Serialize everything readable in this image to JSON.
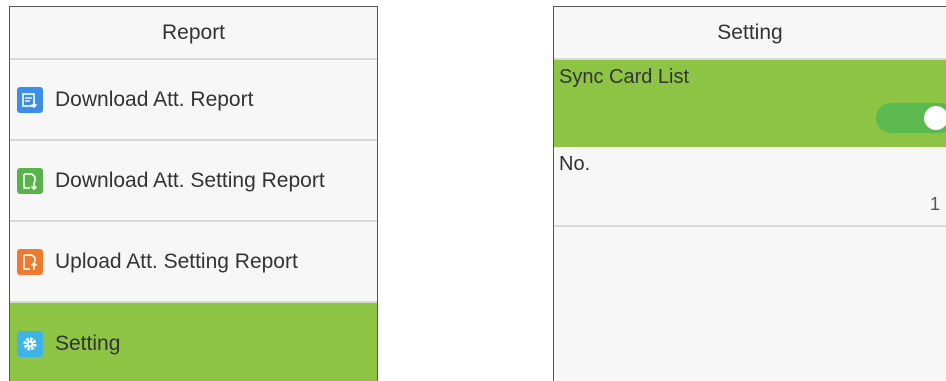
{
  "left_screen": {
    "title": "Report",
    "items": [
      {
        "label": "Download Att. Report",
        "icon": "download-report-icon",
        "icon_color": "#3d8ee8",
        "active": false
      },
      {
        "label": "Download Att. Setting Report",
        "icon": "download-setting-report-icon",
        "icon_color": "#59b34a",
        "active": false
      },
      {
        "label": "Upload Att. Setting Report",
        "icon": "upload-setting-report-icon",
        "icon_color": "#ee7a2d",
        "active": false
      },
      {
        "label": "Setting",
        "icon": "gear-icon",
        "icon_color": "#3db4e8",
        "active": true
      }
    ]
  },
  "right_screen": {
    "title": "Setting",
    "sync_card_list": {
      "label": "Sync Card List",
      "enabled": true
    },
    "number": {
      "label": "No.",
      "value": "1"
    }
  },
  "colors": {
    "active_bg": "#8dc443",
    "toggle_on": "#5cb94f",
    "screen_bg": "#f7f7f7"
  }
}
